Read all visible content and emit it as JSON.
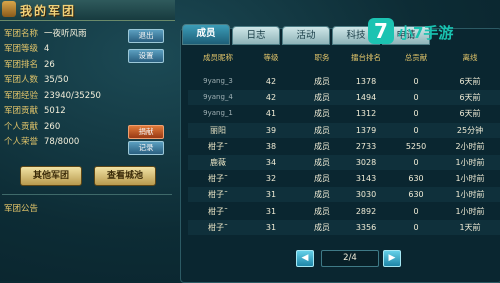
{
  "header": {
    "title": "我的军团"
  },
  "info": {
    "rows": [
      {
        "label": "军团名称",
        "value": "一夜听风雨"
      },
      {
        "label": "军团等级",
        "value": "4"
      },
      {
        "label": "军团排名",
        "value": "26"
      },
      {
        "label": "军团人数",
        "value": "35/50"
      },
      {
        "label": "军团经验",
        "value": "23940/35250"
      },
      {
        "label": "军团贡献",
        "value": "5012"
      },
      {
        "label": "个人贡献",
        "value": "260"
      },
      {
        "label": "个人荣誉",
        "value": "78/8000"
      }
    ],
    "btn_exit": "退出",
    "btn_settings": "设置",
    "btn_donate": "捐献",
    "btn_honor": "记录",
    "btn_other_guilds": "其他军团",
    "btn_view_city": "查看城池",
    "notice_label": "军团公告"
  },
  "tabs": [
    "成员",
    "日志",
    "活动",
    "科技",
    "申请"
  ],
  "active_tab": 0,
  "table": {
    "headers": [
      "成员昵称",
      "等级",
      "职务",
      "擂台排名",
      "总贡献",
      "离线"
    ],
    "rows": [
      {
        "name": "9yang_3",
        "level": "42",
        "role": "成员",
        "rank": "1378",
        "contrib": "0",
        "offline": "6天前"
      },
      {
        "name": "9yang_4",
        "level": "42",
        "role": "成员",
        "rank": "1494",
        "contrib": "0",
        "offline": "6天前"
      },
      {
        "name": "9yang_1",
        "level": "41",
        "role": "成员",
        "rank": "1312",
        "contrib": "0",
        "offline": "6天前"
      },
      {
        "name": "丽阳",
        "level": "39",
        "role": "成员",
        "rank": "1379",
        "contrib": "0",
        "offline": "25分钟"
      },
      {
        "name": "柑子˜",
        "level": "38",
        "role": "成员",
        "rank": "2733",
        "contrib": "5250",
        "offline": "2小时前"
      },
      {
        "name": "鹿薇",
        "level": "34",
        "role": "成员",
        "rank": "3028",
        "contrib": "0",
        "offline": "1小时前"
      },
      {
        "name": "柑子˜",
        "level": "32",
        "role": "成员",
        "rank": "3143",
        "contrib": "630",
        "offline": "1小时前"
      },
      {
        "name": "柑子˜",
        "level": "31",
        "role": "成员",
        "rank": "3030",
        "contrib": "630",
        "offline": "1小时前"
      },
      {
        "name": "柑子˜",
        "level": "31",
        "role": "成员",
        "rank": "2892",
        "contrib": "0",
        "offline": "1小时前"
      },
      {
        "name": "柑子˜",
        "level": "31",
        "role": "成员",
        "rank": "3356",
        "contrib": "0",
        "offline": "1天前"
      }
    ]
  },
  "pager": {
    "label": "2/4",
    "prev": "◀",
    "next": "▶"
  },
  "watermark": {
    "icon": "7",
    "text": "小7手游"
  }
}
